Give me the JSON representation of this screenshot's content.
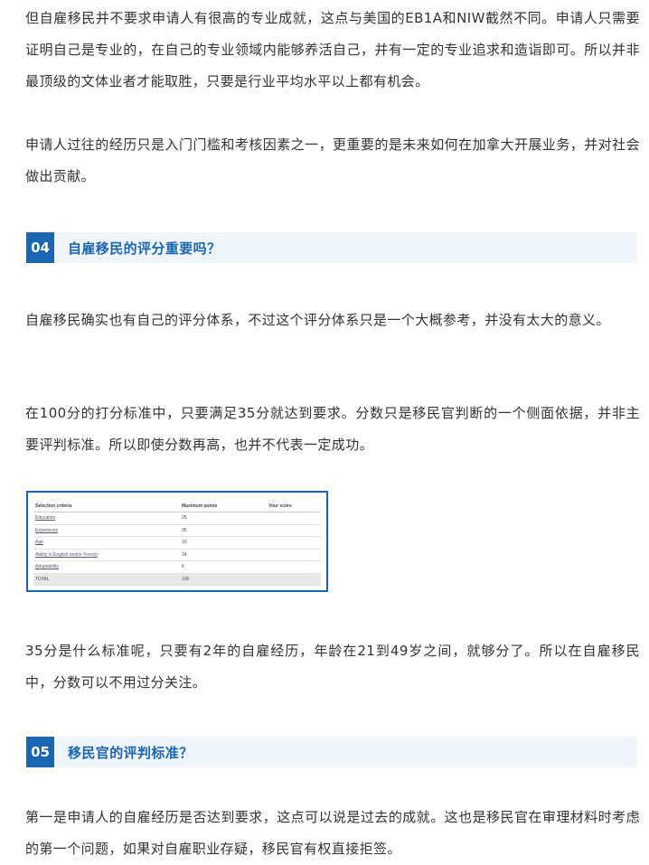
{
  "paragraphs": {
    "p1": "但自雇移民并不要求申请人有很高的专业成就，这点与美国的EB1A和NIW截然不同。申请人只需要证明自己是专业的，在自己的专业领域内能够养活自己，并有一定的专业追求和造诣即可。所以并非最顶级的文体业者才能取胜，只要是行业平均水平以上都有机会。",
    "p2": "申请人过往的经历只是入门门槛和考核因素之一，更重要的是未来如何在加拿大开展业务，并对社会做出贡献。",
    "p3": "自雇移民确实也有自己的评分体系，不过这个评分体系只是一个大概参考，并没有太大的意义。",
    "p4": "在100分的打分标准中，只要满足35分就达到要求。分数只是移民官判断的一个侧面依据，并非主要评判标准。所以即使分数再高，也并不代表一定成功。",
    "p5": "35分是什么标准呢，只要有2年的自雇经历，年龄在21到49岁之间，就够分了。所以在自雇移民中，分数可以不用过分关注。",
    "p6": "第一是申请人的自雇经历是否达到要求，这点可以说是过去的成就。这也是移民官在审理材料时考虑的第一个问题，如果对自雇职业存疑，移民官有权直接拒签。"
  },
  "sections": {
    "s04": {
      "number": "04",
      "title": "自雇移民的评分重要吗？"
    },
    "s05": {
      "number": "05",
      "title": "移民官的评判标准？"
    }
  },
  "score_table": {
    "headers": {
      "criteria": "Selection criteria",
      "max": "Maximum points",
      "score": "Your score"
    },
    "rows": [
      {
        "criteria": "Education",
        "max": "25",
        "score": ""
      },
      {
        "criteria": "Experience",
        "max": "35",
        "score": ""
      },
      {
        "criteria": "Age",
        "max": "10",
        "score": ""
      },
      {
        "criteria": "Ability in English and/or French",
        "max": "24",
        "score": ""
      },
      {
        "criteria": "Adaptability",
        "max": "6",
        "score": ""
      },
      {
        "criteria": "TOTAL",
        "max": "100",
        "score": ""
      }
    ]
  },
  "colors": {
    "accent": "#1a66b3",
    "header_background": "#f0f5fb",
    "body_text": "#333333"
  }
}
